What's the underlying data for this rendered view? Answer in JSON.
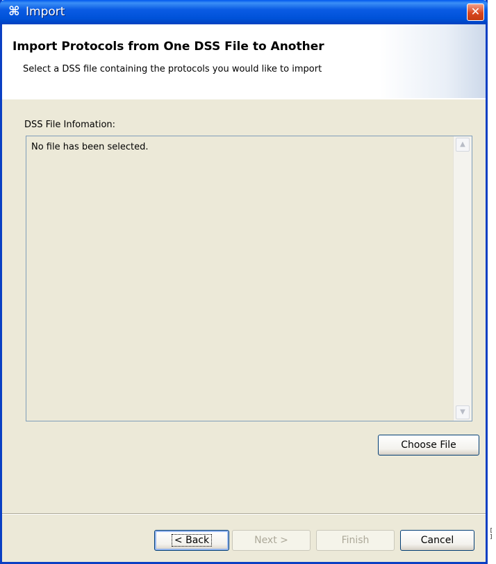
{
  "window": {
    "title": "Import",
    "title_icon": "⌘",
    "close_glyph": "✕"
  },
  "banner": {
    "title": "Import Protocols from One DSS File to Another",
    "description": "Select a DSS file containing the protocols you would like to import"
  },
  "file_info": {
    "label": "DSS File Infomation:",
    "content": "No file has been selected."
  },
  "buttons": {
    "choose_file": "Choose File",
    "back": "< Back",
    "next": "Next >",
    "finish": "Finish",
    "cancel": "Cancel"
  },
  "side_mark": "[ ]"
}
